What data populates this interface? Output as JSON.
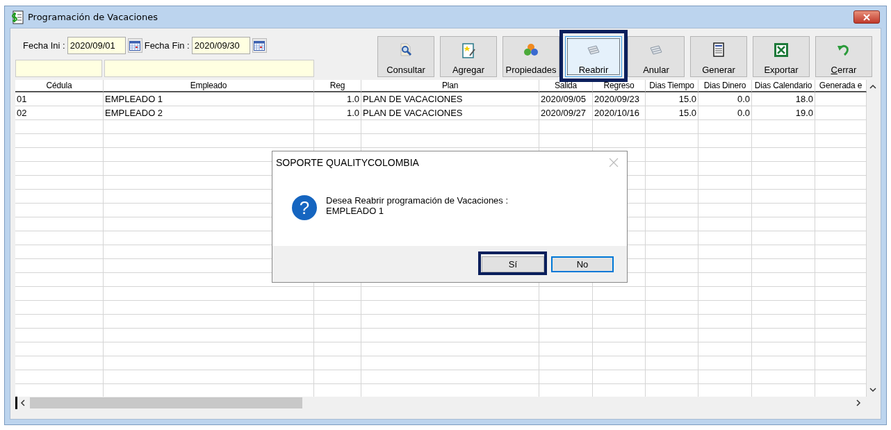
{
  "window": {
    "title": "Programación de Vacaciones"
  },
  "date_filters": [
    {
      "label": "Fecha Ini :",
      "value": "2020/09/01"
    },
    {
      "label": "Fecha Fin :",
      "value": "2020/09/30"
    }
  ],
  "toolbar": [
    {
      "label": "Consultar",
      "kind": "search",
      "focused": false,
      "highlighted": false,
      "mnemonic": false
    },
    {
      "label": "Agregar",
      "kind": "add",
      "focused": false,
      "highlighted": false,
      "mnemonic": false
    },
    {
      "label": "Propiedades",
      "kind": "properties",
      "focused": false,
      "highlighted": false,
      "mnemonic": false
    },
    {
      "label": "Reabrir",
      "kind": "reopen",
      "focused": true,
      "highlighted": true,
      "mnemonic": false
    },
    {
      "label": "Anular",
      "kind": "reopen",
      "focused": false,
      "highlighted": false,
      "mnemonic": false
    },
    {
      "label": "Generar",
      "kind": "document",
      "focused": false,
      "highlighted": false,
      "mnemonic": false
    },
    {
      "label": "Exportar",
      "kind": "excel",
      "focused": false,
      "highlighted": false,
      "mnemonic": false
    },
    {
      "label": "Cerrar",
      "kind": "undo",
      "focused": false,
      "highlighted": false,
      "mnemonic": true
    }
  ],
  "table": {
    "columns": [
      "Cédula",
      "Empleado",
      "Reg",
      "Plan",
      "Salida",
      "Regreso",
      "Dias Tiempo",
      "Dias Dinero",
      "Dias Calendario",
      "Generada e"
    ],
    "rows": [
      [
        "01",
        "EMPLEADO 1",
        "1.0",
        "PLAN DE VACACIONES",
        "2020/09/05",
        "2020/09/23",
        "15.0",
        "0.0",
        "18.0"
      ],
      [
        "02",
        "EMPLEADO 2",
        "1.0",
        "PLAN DE VACACIONES",
        "2020/09/27",
        "2020/10/16",
        "15.0",
        "0.0",
        "19.0"
      ]
    ]
  },
  "dialog": {
    "title": "SOPORTE QUALITYCOLOMBIA",
    "icon_glyph": "?",
    "message": [
      "Desea Reabrir programación de Vacaciones :",
      "EMPLEADO 1"
    ],
    "buttons": [
      {
        "label": "Sí",
        "highlighted": true,
        "focused": false
      },
      {
        "label": "No",
        "highlighted": false,
        "focused": true
      }
    ]
  }
}
